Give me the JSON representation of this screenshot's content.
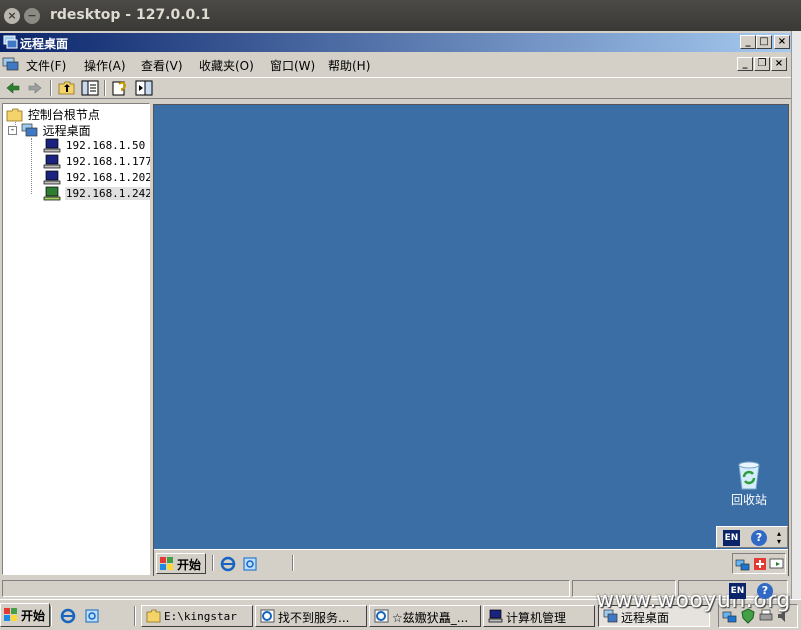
{
  "outer_window": {
    "title": "rdesktop - 127.0.0.1"
  },
  "mmc": {
    "title": "远程桌面",
    "menu": [
      "文件(F)",
      "操作(A)",
      "查看(V)",
      "收藏夹(O)",
      "窗口(W)",
      "帮助(H)"
    ],
    "tree": {
      "root": "控制台根节点",
      "child": "远程桌面",
      "hosts": [
        "192.168.1.50",
        "192.168.1.177",
        "192.168.1.202",
        "192.168.1.242"
      ]
    }
  },
  "remote_desktop": {
    "recycle_bin": "回收站",
    "lang": "EN",
    "help": "?",
    "start": "开始"
  },
  "taskbar": {
    "start": "开始",
    "lang": "EN",
    "help": "?",
    "items": [
      "E:\\kingstar",
      "找不到服务...",
      "☆兹嫐犾矗_...",
      "计算机管理",
      "远程桌面"
    ]
  },
  "watermark": "www.wooyun.org"
}
